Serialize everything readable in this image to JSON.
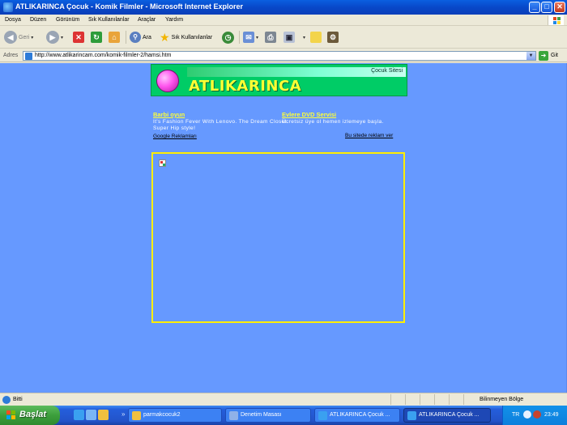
{
  "window": {
    "title": "ATLIKARINCA Çocuk - Komik Filmler - Microsoft Internet Explorer",
    "buttons": {
      "minimize": "_",
      "maximize": "□",
      "close": "✕"
    }
  },
  "menu": [
    "Dosya",
    "Düzen",
    "Görünüm",
    "Sık Kullanılanlar",
    "Araçlar",
    "Yardım"
  ],
  "toolbar": {
    "back": "Geri",
    "search": "Ara",
    "favorites": "Sık Kullanılanlar"
  },
  "address": {
    "label": "Adres",
    "url": "http://www.atlikarincam.com/komik-filmler-2/hamsi.htm",
    "go": "Git"
  },
  "page": {
    "banner_tagline": "Çocuk Sitesi",
    "logo_text": "ATLIKARINCA",
    "ads": [
      {
        "title": "Barbi oyun",
        "desc": "It's Fashion Fever With Lenovo. The Dream Closet. Super Hip style!"
      },
      {
        "title": "Evlere DVD Servisi",
        "desc": "Ücretsiz üye ol hemen izlemeye başla."
      }
    ],
    "google_ads_link": "Google Reklamları",
    "advertise_link": "Bu sitede reklam ver"
  },
  "status": {
    "text": "Bitti",
    "zone": "Bilinmeyen Bölge"
  },
  "taskbar": {
    "start": "Başlat",
    "more": "»",
    "tasks": [
      "parmakcocuk2",
      "Denetim Masası",
      "ATLIKARINCA Çocuk ...",
      "ATLIKARINCA Çocuk ..."
    ],
    "lang": "TR",
    "clock": "23:49"
  },
  "colors": {
    "page_background": "#6699ff",
    "banner_green": "#00cc66",
    "logo_yellow": "#ffff33",
    "flash_border": "#ffee00"
  }
}
